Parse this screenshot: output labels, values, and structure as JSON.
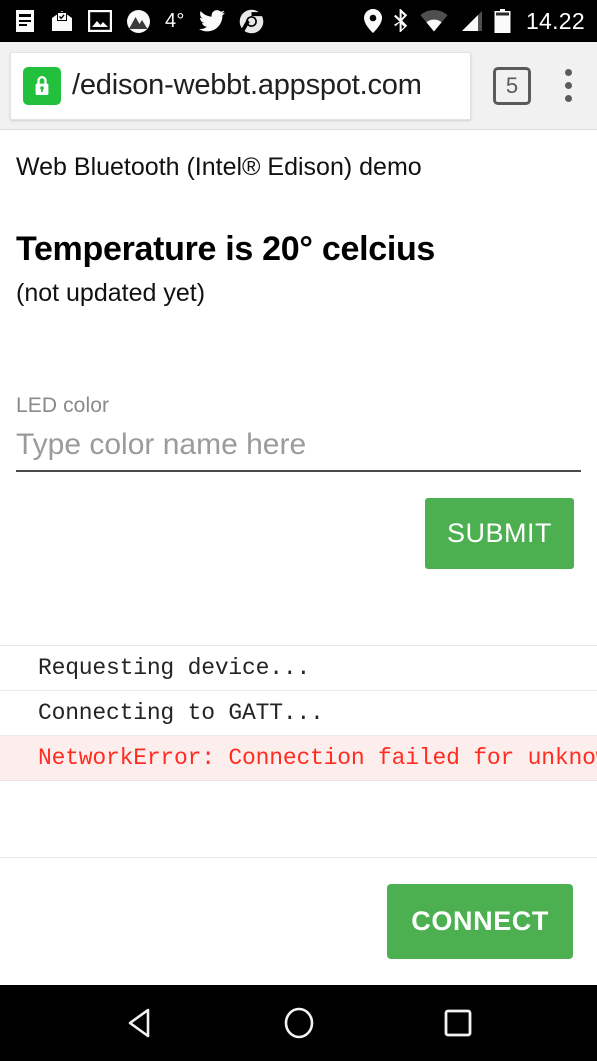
{
  "statusbar": {
    "icons_left": [
      "news-icon",
      "inbox-icon",
      "photos-icon",
      "weather-mountain-icon"
    ],
    "temperature": "4°",
    "icons_left_after": [
      "twitter-icon",
      "chrome-icon"
    ],
    "icons_right": [
      "location-icon",
      "bluetooth-icon",
      "wifi-icon",
      "cellular-signal-icon",
      "battery-icon"
    ],
    "clock": "14.22"
  },
  "browser": {
    "security_icon": "lock-icon",
    "url": "/edison-webbt.appspot.com",
    "tab_count": "5",
    "menu_icon": "overflow-menu-icon"
  },
  "page": {
    "demo_title": "Web Bluetooth (Intel® Edison) demo",
    "temperature_heading": "Temperature is 20° celcius",
    "temperature_status": "(not updated yet)",
    "form": {
      "label": "LED color",
      "placeholder": "Type color name here",
      "value": "",
      "submit_label": "SUBMIT"
    },
    "log": [
      {
        "text": "Requesting device...",
        "level": "info"
      },
      {
        "text": "Connecting to GATT...",
        "level": "info"
      },
      {
        "text": "NetworkError: Connection failed for unknown",
        "level": "error"
      }
    ],
    "connect_label": "CONNECT"
  },
  "colors": {
    "accent_green": "#4CAF50",
    "lock_green": "#22c03c",
    "error_red": "#ff2d21",
    "error_bg": "#fdeeee"
  },
  "navbar": {
    "back": "back-triangle-icon",
    "home": "home-circle-icon",
    "recents": "recents-square-icon"
  }
}
